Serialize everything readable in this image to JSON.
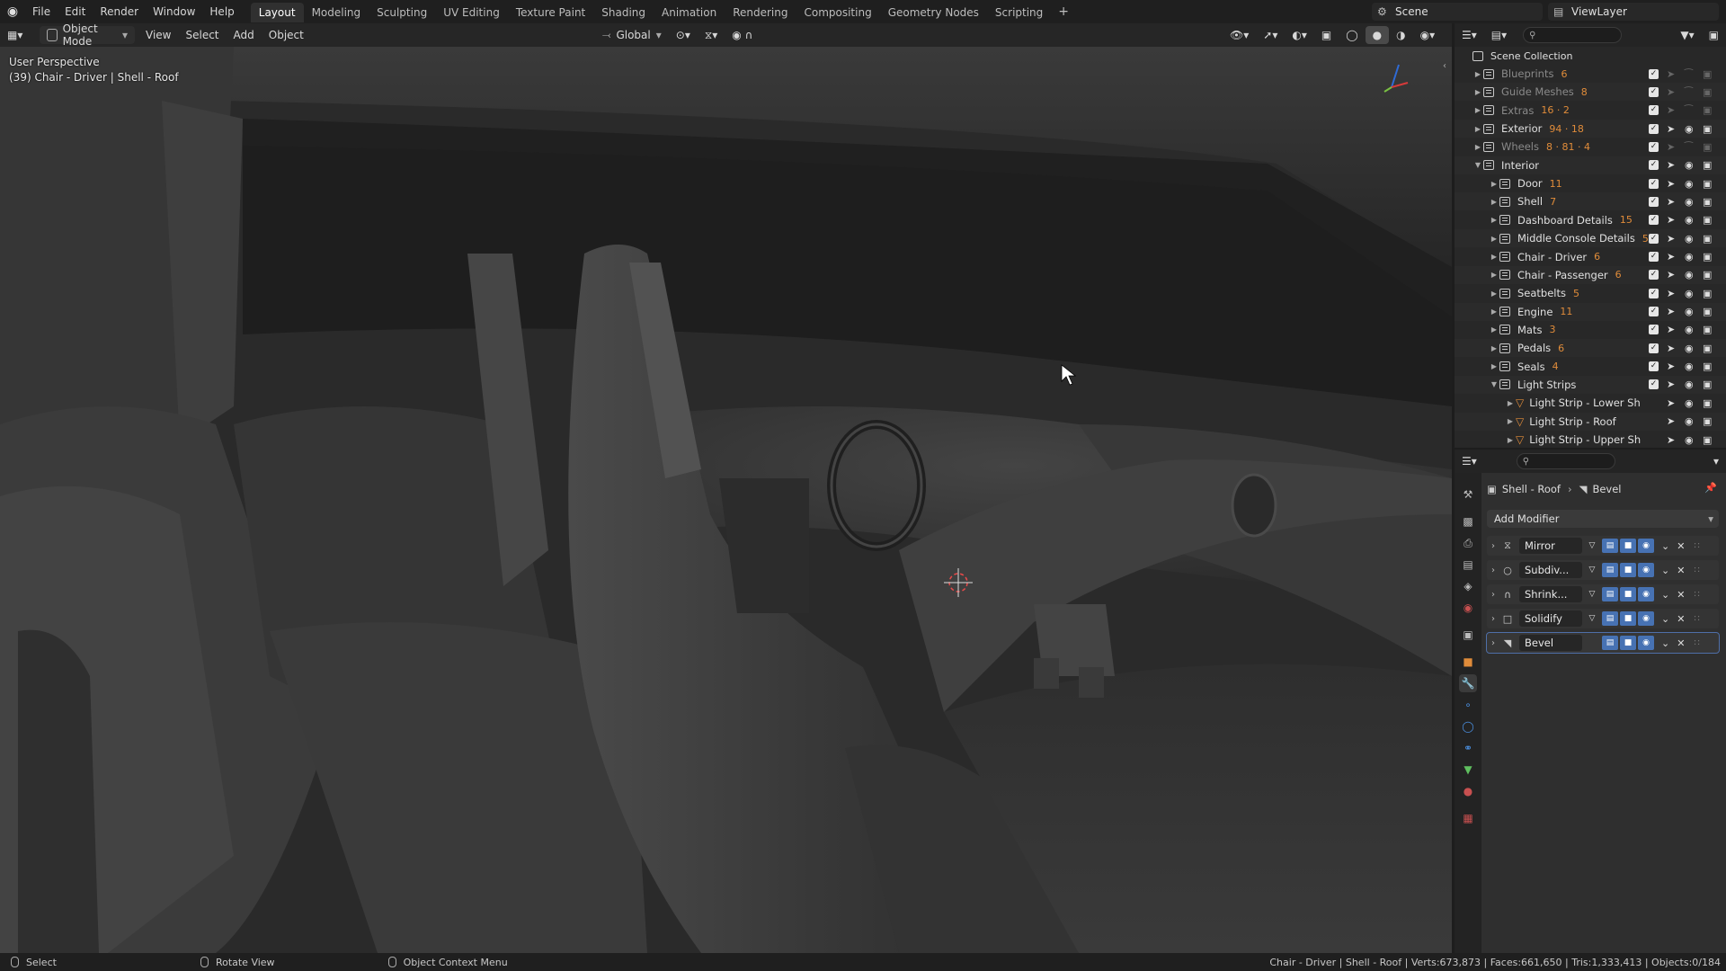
{
  "menu": [
    "File",
    "Edit",
    "Render",
    "Window",
    "Help"
  ],
  "workspaces": [
    {
      "label": "Layout",
      "active": true
    },
    {
      "label": "Modeling"
    },
    {
      "label": "Sculpting"
    },
    {
      "label": "UV Editing"
    },
    {
      "label": "Texture Paint"
    },
    {
      "label": "Shading"
    },
    {
      "label": "Animation"
    },
    {
      "label": "Rendering"
    },
    {
      "label": "Compositing"
    },
    {
      "label": "Geometry Nodes"
    },
    {
      "label": "Scripting"
    }
  ],
  "scene_name": "Scene",
  "view_layer": "ViewLayer",
  "header": {
    "mode": "Object Mode",
    "menus": [
      "View",
      "Select",
      "Add",
      "Object"
    ],
    "transform_orientation": "Global"
  },
  "viewport": {
    "perspective": "User Perspective",
    "active_info": "(39) Chair - Driver | Shell - Roof"
  },
  "outliner": {
    "root": "Scene Collection",
    "rows": [
      {
        "name": "Blueprints",
        "depth": 1,
        "dim": true,
        "expanded": false,
        "counts": "6"
      },
      {
        "name": "Guide Meshes",
        "depth": 1,
        "dim": true,
        "expanded": false,
        "counts": "8"
      },
      {
        "name": "Extras",
        "depth": 1,
        "dim": true,
        "expanded": false,
        "counts": "16 · 2"
      },
      {
        "name": "Exterior",
        "depth": 1,
        "expanded": false,
        "counts": "94 · 18"
      },
      {
        "name": "Wheels",
        "depth": 1,
        "dim": true,
        "expanded": false,
        "counts": "8 · 81 · 4"
      },
      {
        "name": "Interior",
        "depth": 1,
        "expanded": true,
        "counts": ""
      },
      {
        "name": "Door",
        "depth": 2,
        "expanded": false,
        "counts": "11"
      },
      {
        "name": "Shell",
        "depth": 2,
        "expanded": false,
        "counts": "7"
      },
      {
        "name": "Dashboard Details",
        "depth": 2,
        "expanded": false,
        "counts": "15"
      },
      {
        "name": "Middle Console Details",
        "depth": 2,
        "expanded": false,
        "counts": "5"
      },
      {
        "name": "Chair - Driver",
        "depth": 2,
        "expanded": false,
        "counts": "6"
      },
      {
        "name": "Chair - Passenger",
        "depth": 2,
        "expanded": false,
        "counts": "6"
      },
      {
        "name": "Seatbelts",
        "depth": 2,
        "expanded": false,
        "counts": "5"
      },
      {
        "name": "Engine",
        "depth": 2,
        "expanded": false,
        "counts": "11"
      },
      {
        "name": "Mats",
        "depth": 2,
        "expanded": false,
        "counts": "3"
      },
      {
        "name": "Pedals",
        "depth": 2,
        "expanded": false,
        "counts": "6"
      },
      {
        "name": "Seals",
        "depth": 2,
        "expanded": false,
        "counts": "4"
      },
      {
        "name": "Light Strips",
        "depth": 2,
        "expanded": true,
        "counts": ""
      },
      {
        "name": "Light Strip - Lower Sh",
        "depth": 3,
        "object": true
      },
      {
        "name": "Light Strip - Roof",
        "depth": 3,
        "object": true
      },
      {
        "name": "Light Strip - Upper Sh",
        "depth": 3,
        "object": true
      }
    ]
  },
  "properties": {
    "object_name": "Shell - Roof",
    "modifier_name": "Bevel",
    "add_modifier": "Add Modifier",
    "modifiers": [
      {
        "name": "Mirror",
        "icon": "mirror-icon"
      },
      {
        "name": "Subdiv...",
        "icon": "subdivision-icon"
      },
      {
        "name": "Shrink...",
        "icon": "shrinkwrap-icon"
      },
      {
        "name": "Solidify",
        "icon": "solidify-icon"
      },
      {
        "name": "Bevel",
        "icon": "bevel-icon",
        "active": true
      }
    ]
  },
  "statusbar": {
    "left": [
      {
        "label": "Select"
      },
      {
        "label": "Rotate View"
      },
      {
        "label": "Object Context Menu"
      }
    ],
    "stats": "Chair - Driver | Shell - Roof | Verts:673,873 | Faces:661,650 | Tris:1,333,413 | Objects:0/184"
  },
  "colors": {
    "accent": "#4772b3",
    "mesh_orange": "#e08c3a",
    "panel_bg": "#282828"
  }
}
